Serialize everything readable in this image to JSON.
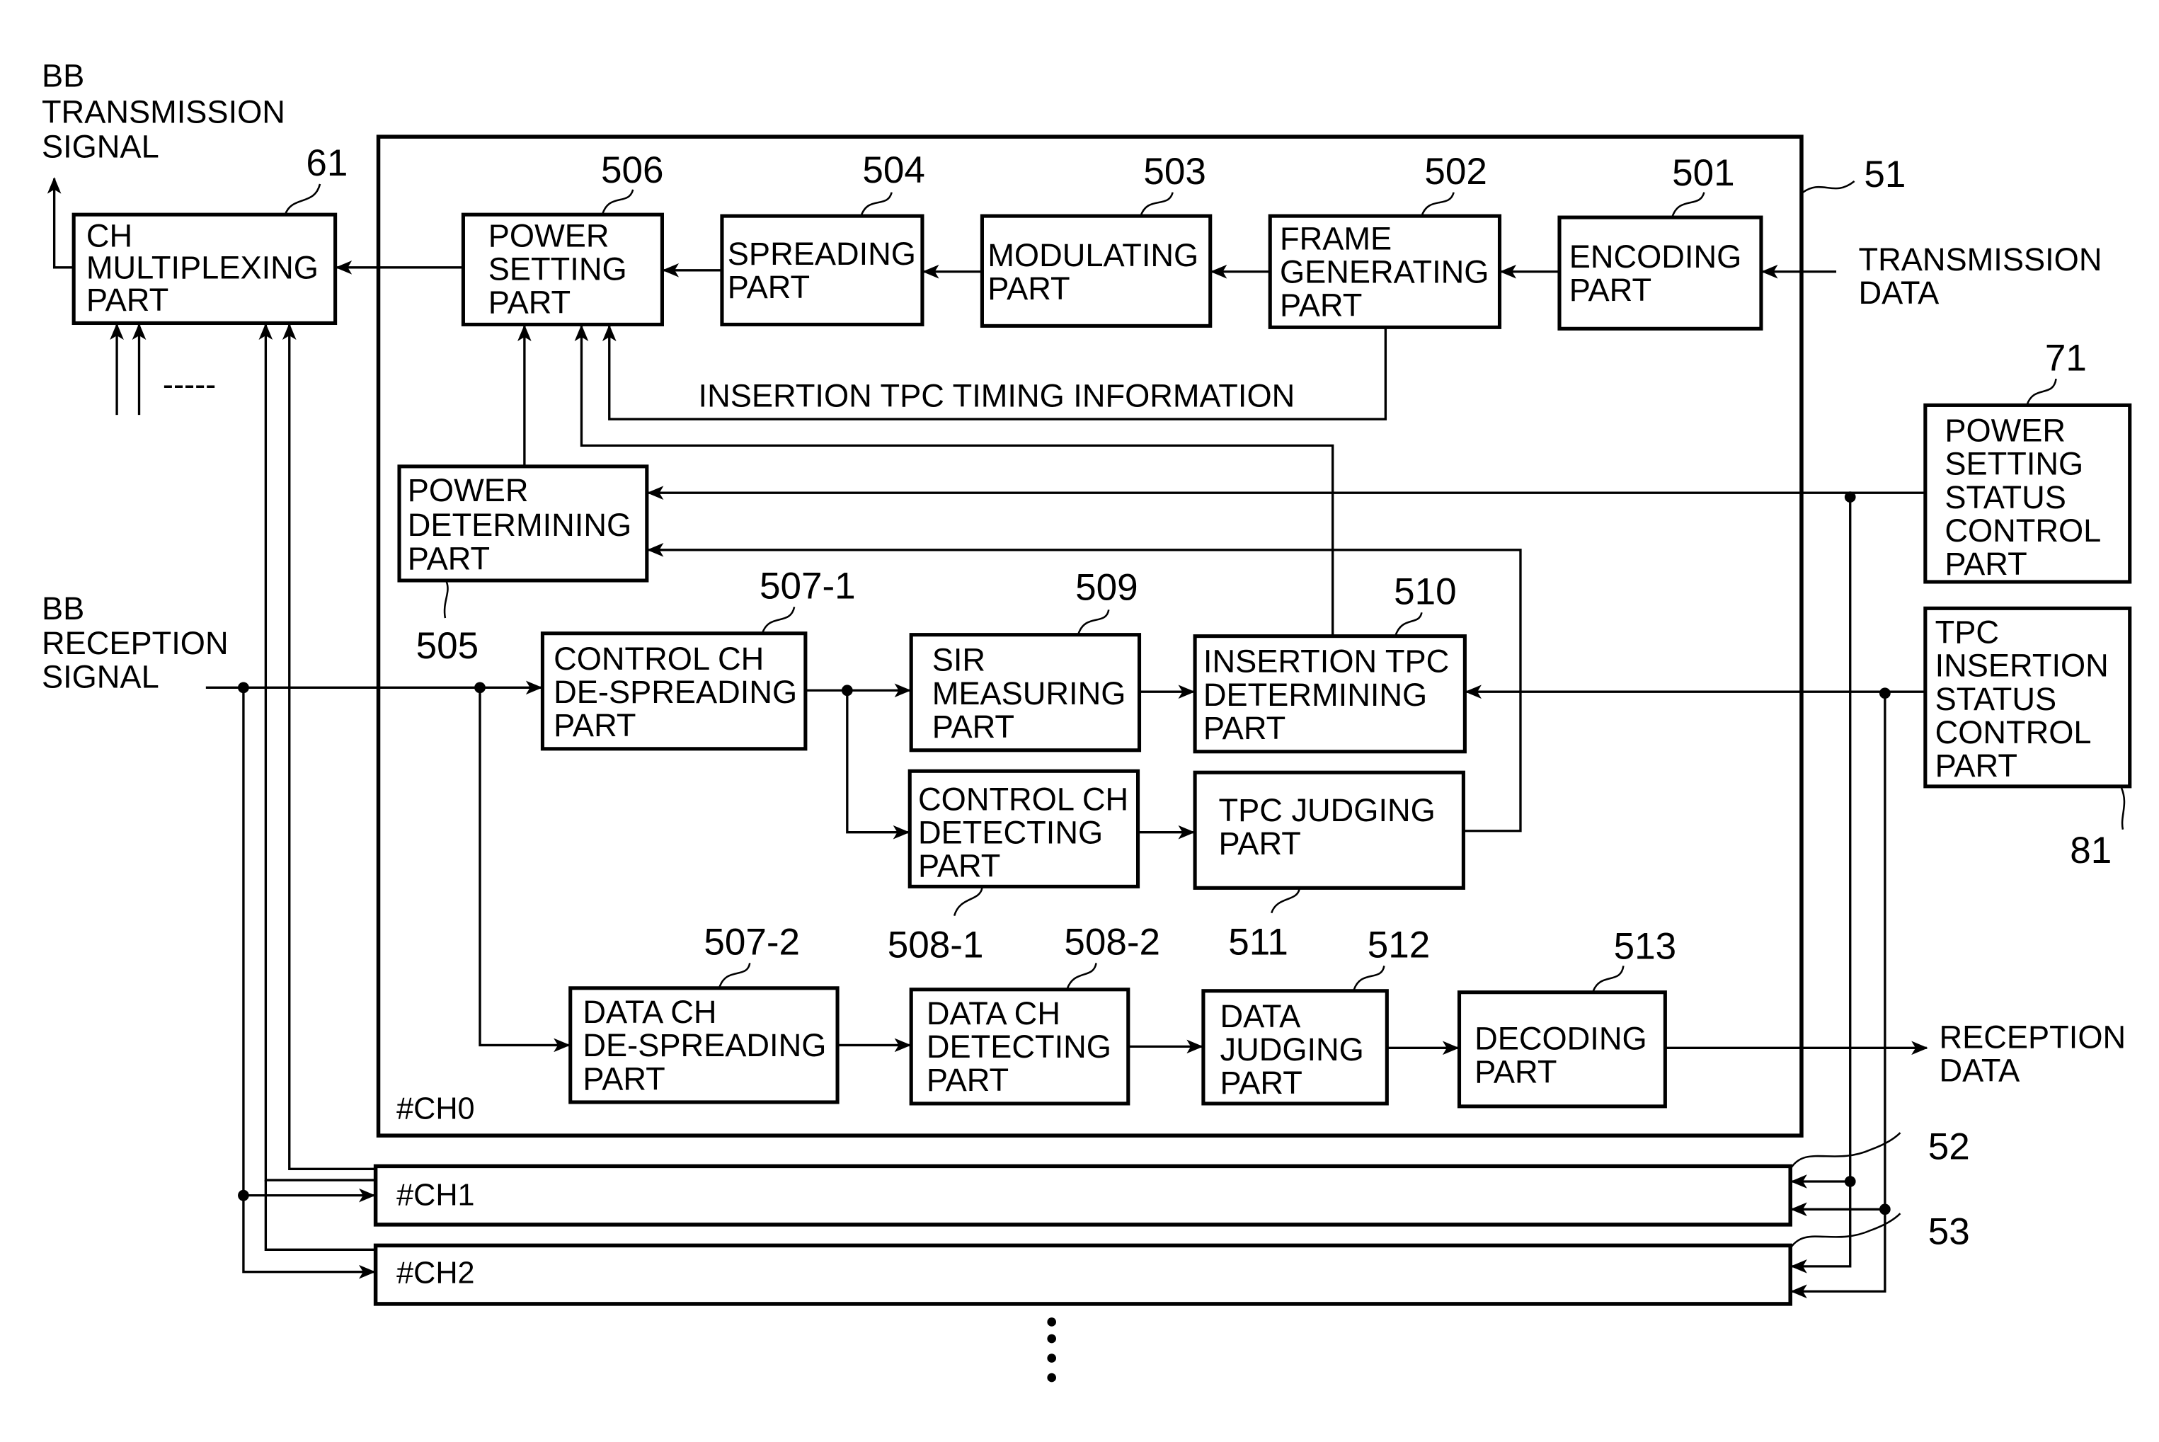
{
  "figure": {
    "blocks": {
      "ch_multiplexing": {
        "ref": "61",
        "lines": [
          "CH",
          "MULTIPLEXING",
          "PART"
        ]
      },
      "power_setting": {
        "ref": "506",
        "lines": [
          "POWER",
          "SETTING",
          "PART"
        ]
      },
      "spreading": {
        "ref": "504",
        "lines": [
          "SPREADING",
          "PART"
        ]
      },
      "modulating": {
        "ref": "503",
        "lines": [
          "MODULATING",
          "PART"
        ]
      },
      "frame_generating": {
        "ref": "502",
        "lines": [
          "FRAME",
          "GENERATING",
          "PART"
        ]
      },
      "encoding": {
        "ref": "501",
        "lines": [
          "ENCODING",
          "PART"
        ]
      },
      "power_determining": {
        "ref": "505",
        "lines": [
          "POWER",
          "DETERMINING",
          "PART"
        ]
      },
      "control_ch_despreading": {
        "ref": "507-1",
        "lines": [
          "CONTROL CH",
          "DE-SPREADING",
          "PART"
        ]
      },
      "sir_measuring": {
        "ref": "509",
        "lines": [
          "SIR",
          "MEASURING",
          "PART"
        ]
      },
      "insertion_tpc_determining": {
        "ref": "510",
        "lines": [
          "INSERTION TPC",
          "DETERMINING",
          "PART"
        ]
      },
      "control_ch_detecting": {
        "ref": "508-1",
        "lines": [
          "CONTROL CH",
          "DETECTING",
          "PART"
        ]
      },
      "tpc_judging": {
        "ref": "511",
        "lines": [
          "TPC JUDGING",
          "PART"
        ]
      },
      "data_ch_despreading": {
        "ref": "507-2",
        "lines": [
          "DATA CH",
          "DE-SPREADING",
          "PART"
        ]
      },
      "data_ch_detecting": {
        "ref": "508-2",
        "lines": [
          "DATA CH",
          "DETECTING",
          "PART"
        ]
      },
      "data_judging": {
        "ref": "512",
        "lines": [
          "DATA",
          "JUDGING",
          "PART"
        ]
      },
      "decoding": {
        "ref": "513",
        "lines": [
          "DECODING",
          "PART"
        ]
      },
      "power_setting_status_control": {
        "ref": "71",
        "lines": [
          "POWER",
          "SETTING",
          "STATUS",
          "CONTROL",
          "PART"
        ]
      },
      "tpc_insertion_status_control": {
        "ref": "81",
        "lines": [
          "TPC",
          "INSERTION",
          "STATUS",
          "CONTROL",
          "PART"
        ]
      }
    },
    "channels": {
      "ch0": {
        "ref": "51",
        "label": "#CH0"
      },
      "ch1": {
        "ref": "52",
        "label": "#CH1"
      },
      "ch2": {
        "ref": "53",
        "label": "#CH2"
      }
    },
    "signals": {
      "bb_transmission": [
        "BB",
        "TRANSMISSION",
        "SIGNAL"
      ],
      "bb_reception": [
        "BB",
        "RECEPTION",
        "SIGNAL"
      ],
      "transmission_data": [
        "TRANSMISSION",
        "DATA"
      ],
      "reception_data": [
        "RECEPTION",
        "DATA"
      ],
      "insertion_tpc_timing": "INSERTION TPC TIMING INFORMATION"
    },
    "dashes": "-----",
    "ellipsis_icon": "vertical-ellipsis"
  }
}
